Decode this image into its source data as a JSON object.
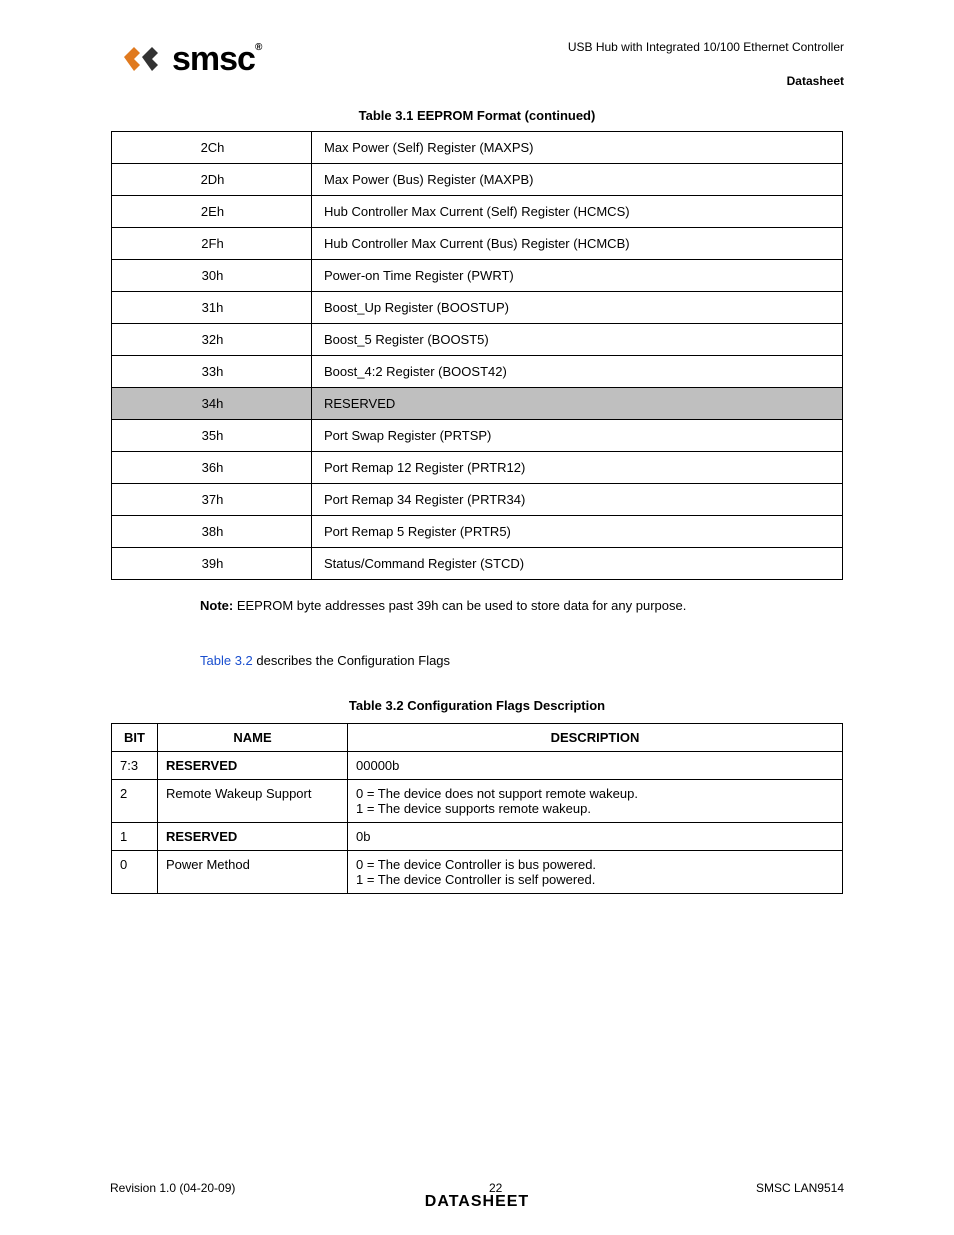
{
  "header": {
    "product_line": "USB Hub with Integrated 10/100 Ethernet Controller",
    "datasheet_label": "Datasheet",
    "logo_text": "smsc",
    "logo_reg": "®"
  },
  "table1": {
    "title": "Table 3.1 EEPROM Format (continued)",
    "rows": [
      {
        "addr": "2Ch",
        "desc": "Max Power (Self) Register (MAXPS)",
        "shaded": false
      },
      {
        "addr": "2Dh",
        "desc": "Max Power (Bus) Register (MAXPB)",
        "shaded": false
      },
      {
        "addr": "2Eh",
        "desc": "Hub Controller Max Current (Self) Register (HCMCS)",
        "shaded": false
      },
      {
        "addr": "2Fh",
        "desc": "Hub Controller Max Current (Bus) Register (HCMCB)",
        "shaded": false
      },
      {
        "addr": "30h",
        "desc": "Power-on Time Register (PWRT)",
        "shaded": false
      },
      {
        "addr": "31h",
        "desc": "Boost_Up Register (BOOSTUP)",
        "shaded": false
      },
      {
        "addr": "32h",
        "desc": "Boost_5 Register (BOOST5)",
        "shaded": false
      },
      {
        "addr": "33h",
        "desc": "Boost_4:2 Register (BOOST42)",
        "shaded": false
      },
      {
        "addr": "34h",
        "desc": "RESERVED",
        "shaded": true
      },
      {
        "addr": "35h",
        "desc": "Port Swap Register (PRTSP)",
        "shaded": false
      },
      {
        "addr": "36h",
        "desc": "Port Remap 12 Register (PRTR12)",
        "shaded": false
      },
      {
        "addr": "37h",
        "desc": "Port Remap 34 Register (PRTR34)",
        "shaded": false
      },
      {
        "addr": "38h",
        "desc": "Port Remap 5 Register (PRTR5)",
        "shaded": false
      },
      {
        "addr": "39h",
        "desc": "Status/Command Register (STCD)",
        "shaded": false
      }
    ]
  },
  "note": {
    "label": "Note:",
    "text": "EEPROM byte addresses past 39h can be used to store data for any purpose."
  },
  "crossref": {
    "link_text": "Table 3.2",
    "rest": " describes the Configuration Flags"
  },
  "table2": {
    "title": "Table 3.2 Configuration Flags Description",
    "headers": {
      "bit": "BIT",
      "name": "NAME",
      "desc": "DESCRIPTION"
    },
    "rows": [
      {
        "bit": "7:3",
        "name": "RESERVED",
        "name_bold": true,
        "desc": [
          "00000b"
        ]
      },
      {
        "bit": "2",
        "name": "Remote Wakeup Support",
        "name_bold": false,
        "desc": [
          "0 = The device does not support remote wakeup.",
          "1 = The device supports remote wakeup."
        ]
      },
      {
        "bit": "1",
        "name": "RESERVED",
        "name_bold": true,
        "desc": [
          "0b"
        ]
      },
      {
        "bit": "0",
        "name": "Power Method",
        "name_bold": false,
        "desc": [
          "0 = The device Controller is bus powered.",
          "1 = The device Controller is self powered."
        ]
      }
    ]
  },
  "footer": {
    "left": "Revision 1.0 (04-20-09)",
    "center": "22",
    "right": "SMSC LAN9514",
    "bottom": "DATASHEET"
  }
}
